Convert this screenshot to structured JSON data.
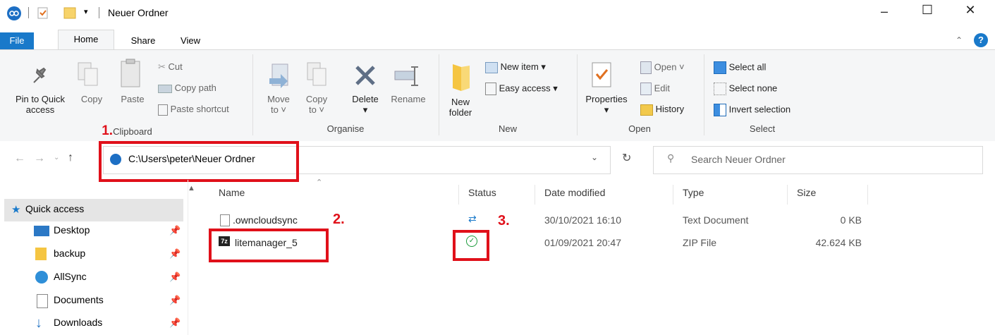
{
  "window": {
    "title": "Neuer Ordner"
  },
  "tabs": [
    "File",
    "Home",
    "Share",
    "View"
  ],
  "ribbon": {
    "clipboard": {
      "pin_line1": "Pin to Quick",
      "pin_line2": "access",
      "copy": "Copy",
      "paste": "Paste",
      "cut": "Cut",
      "copy_path": "Copy path",
      "paste_shortcut": "Paste shortcut",
      "label": "Clipboard"
    },
    "organise": {
      "move_line1": "Move",
      "move_line2": "to ˅",
      "copy_line1": "Copy",
      "copy_line2": "to ˅",
      "delete": "Delete",
      "rename": "Rename",
      "label": "Organise"
    },
    "new": {
      "folder_line1": "New",
      "folder_line2": "folder",
      "new_item": "New item ▾",
      "easy_access": "Easy access ▾",
      "label": "New"
    },
    "open": {
      "properties": "Properties",
      "open": "Open ˅",
      "edit": "Edit",
      "history": "History",
      "label": "Open"
    },
    "select": {
      "select_all": "Select all",
      "select_none": "Select none",
      "invert": "Invert selection",
      "label": "Select"
    }
  },
  "address": {
    "path": "C:\\Users\\peter\\Neuer Ordner",
    "search_placeholder": "Search Neuer Ordner"
  },
  "nav": [
    {
      "label": "Quick access",
      "pinned": false
    },
    {
      "label": "Desktop",
      "pinned": true
    },
    {
      "label": "backup",
      "pinned": true
    },
    {
      "label": "AllSync",
      "pinned": true
    },
    {
      "label": "Documents",
      "pinned": true
    },
    {
      "label": "Downloads",
      "pinned": true
    }
  ],
  "columns": [
    "Name",
    "Status",
    "Date modified",
    "Type",
    "Size"
  ],
  "files": [
    {
      "name": ".owncloudsync",
      "date": "30/10/2021 16:10",
      "type": "Text Document",
      "size": "0 KB"
    },
    {
      "name": "litemanager_5",
      "date": "01/09/2021 20:47",
      "type": "ZIP File",
      "size": "42.624 KB"
    }
  ],
  "annotations": [
    "1.",
    "2.",
    "3."
  ],
  "colors": {
    "accent": "#1979ca",
    "annotation": "#e0101a",
    "sync_ok": "#1a9a3a"
  }
}
